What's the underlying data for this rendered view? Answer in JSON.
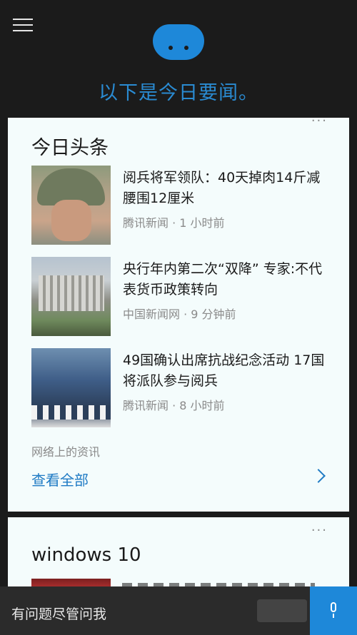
{
  "header": {
    "greeting": "以下是今日要闻。"
  },
  "top_news_card": {
    "title": "今日头条",
    "more": "···",
    "items": [
      {
        "headline": "阅兵将军领队：40天掉肉14斤减腰围12厘米",
        "meta": "腾讯新闻 · 1 小时前"
      },
      {
        "headline": "央行年内第二次“双降” 专家:不代表货币政策转向",
        "meta": "中国新闻网 · 9 分钟前"
      },
      {
        "headline": "49国确认出席抗战纪念活动 17国将派队参与阅兵",
        "meta": "腾讯新闻 · 8 小时前"
      }
    ],
    "source_label": "网络上的资讯",
    "see_all": "查看全部"
  },
  "second_card": {
    "title": "windows 10",
    "more": "···"
  },
  "search": {
    "placeholder": "有问题尽管问我"
  },
  "colors": {
    "accent": "#1e88d9",
    "link": "#1e7ac4",
    "background": "#1b1b1b",
    "card": "#f4fcfc"
  }
}
